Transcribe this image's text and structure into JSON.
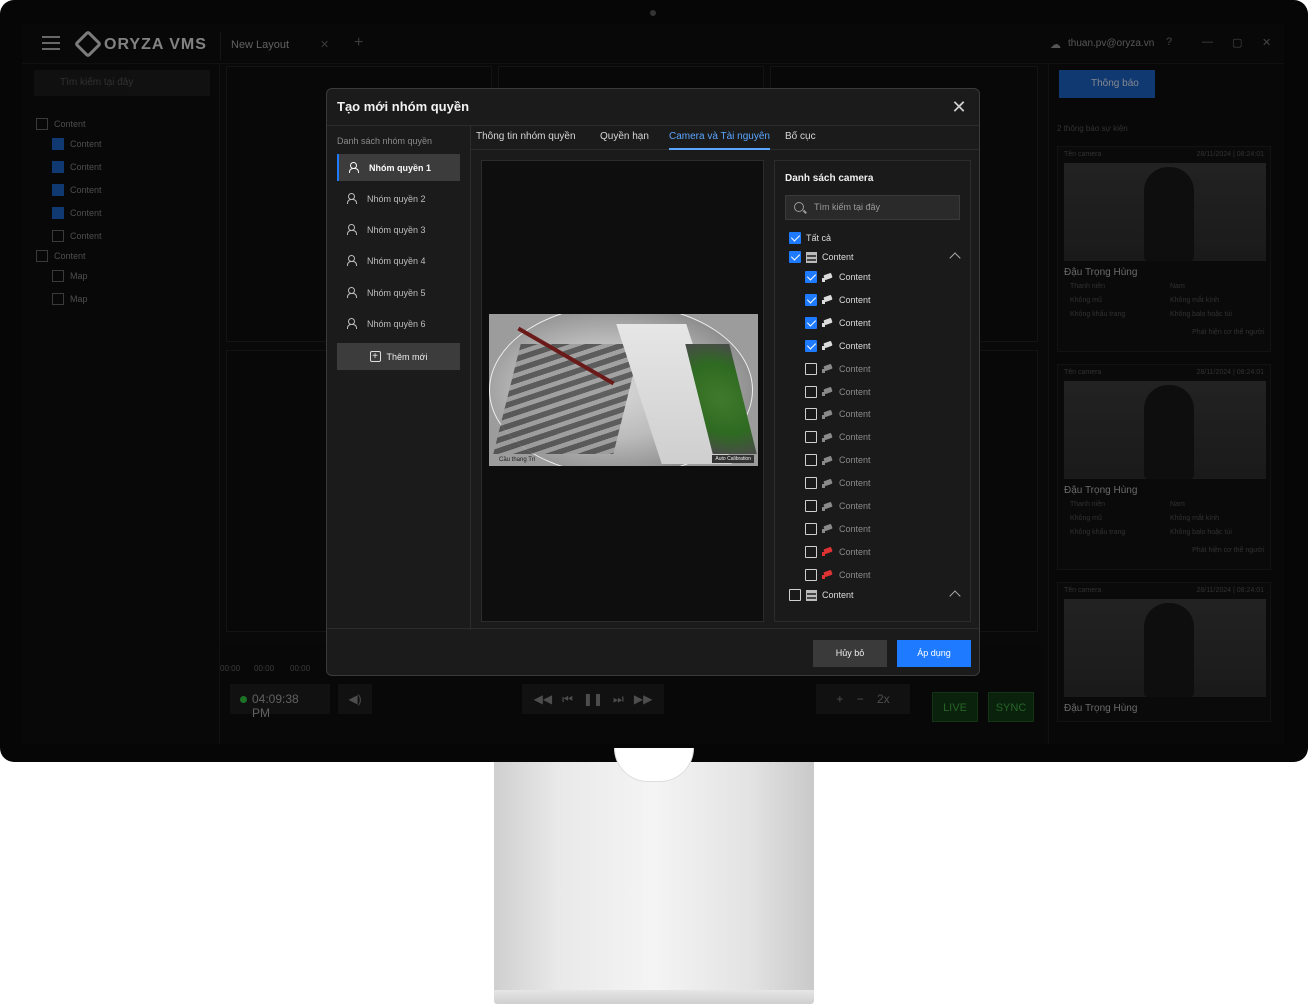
{
  "app": {
    "logo_text": "ORYZA VMS",
    "layout_tab": "New Layout",
    "user_email": "thuan.pv@oryza.vn",
    "side_search_placeholder": "Tìm kiếm tại đây",
    "sidebar_items": [
      {
        "label": "Content",
        "type": "group"
      },
      {
        "label": "Content",
        "checked": true
      },
      {
        "label": "Content",
        "checked": true
      },
      {
        "label": "Content",
        "checked": true
      },
      {
        "label": "Content",
        "checked": true
      },
      {
        "label": "Content",
        "checked": false
      },
      {
        "label": "Content",
        "type": "group"
      },
      {
        "label": "Map",
        "checked": false
      },
      {
        "label": "Map",
        "checked": false
      }
    ],
    "timeline_ticks": [
      "00:00",
      "00:00",
      "00:00"
    ],
    "clock": "04:09:38 PM",
    "speed": "2x",
    "live_label": "LIVE",
    "sync_label": "SYNC",
    "notifications_label": "Thông báo",
    "event_count": "2 thông báo sự kiện",
    "events": [
      {
        "camera": "Tên camera",
        "date": "28/11/2024 | 08:24:01",
        "name": "Đậu Trọng Hùng",
        "attrs_left": [
          "Thanh niên",
          "Không mũ",
          "Không khẩu trang"
        ],
        "attrs_right": [
          "Nam",
          "Không mắt kính",
          "Không balo hoặc túi"
        ],
        "foot_right": "Phát hiện cơ thể người"
      },
      {
        "camera": "Tên camera",
        "date": "28/11/2024 | 08:24:01",
        "name": "Đậu Trọng Hùng",
        "attrs_left": [
          "Thanh niên",
          "Không mũ",
          "Không khẩu trang"
        ],
        "attrs_right": [
          "Nam",
          "Không mắt kính",
          "Không balo hoặc túi"
        ],
        "foot_right": "Phát hiện cơ thể người"
      },
      {
        "camera": "Tên camera",
        "date": "28/11/2024 | 08:24:01",
        "name": "Đậu Trọng Hùng"
      }
    ]
  },
  "modal": {
    "title": "Tạo mới nhóm quyền",
    "close_icon": "close-icon",
    "groups_title": "Danh sách nhóm quyền",
    "groups": [
      "Nhóm quyền 1",
      "Nhóm quyền 2",
      "Nhóm quyền 3",
      "Nhóm quyền 4",
      "Nhóm quyền 5",
      "Nhóm quyền 6"
    ],
    "add_group": "Thêm mới",
    "tabs": [
      "Thông tin nhóm quyền",
      "Quyền hạn",
      "Camera và Tài nguyên",
      "Bố cục"
    ],
    "active_tab": "Camera và Tài nguyên",
    "preview_label": "Cầu thang Trí",
    "preview_badge": "Auto Calibration",
    "camera_list_title": "Danh sách camera",
    "search_placeholder": "Tìm kiếm tại đây",
    "select_all": "Tất cả",
    "group1_label": "Content",
    "cameras": [
      {
        "label": "Content",
        "checked": true,
        "icon": "camera-icon"
      },
      {
        "label": "Content",
        "checked": true,
        "icon": "camera-icon"
      },
      {
        "label": "Content",
        "checked": true,
        "icon": "camera-icon"
      },
      {
        "label": "Content",
        "checked": true,
        "icon": "camera-icon"
      },
      {
        "label": "Content",
        "checked": false,
        "icon": "camera-icon"
      },
      {
        "label": "Content",
        "checked": false,
        "icon": "camera-icon"
      },
      {
        "label": "Content",
        "checked": false,
        "icon": "camera-icon"
      },
      {
        "label": "Content",
        "checked": false,
        "icon": "camera-icon"
      },
      {
        "label": "Content",
        "checked": false,
        "icon": "camera-icon"
      },
      {
        "label": "Content",
        "checked": false,
        "icon": "camera-icon"
      },
      {
        "label": "Content",
        "checked": false,
        "icon": "camera-icon"
      },
      {
        "label": "Content",
        "checked": false,
        "icon": "camera-icon"
      },
      {
        "label": "Content",
        "checked": false,
        "icon": "camera-alert-icon"
      },
      {
        "label": "Content",
        "checked": false,
        "icon": "camera-alert-icon"
      }
    ],
    "group2_label": "Content",
    "cancel_label": "Hủy bỏ",
    "apply_label": "Áp dụng",
    "colors": {
      "accent": "#1e7bff",
      "panel": "#1b1b1b",
      "active_tab": "#5aa6ff"
    }
  }
}
